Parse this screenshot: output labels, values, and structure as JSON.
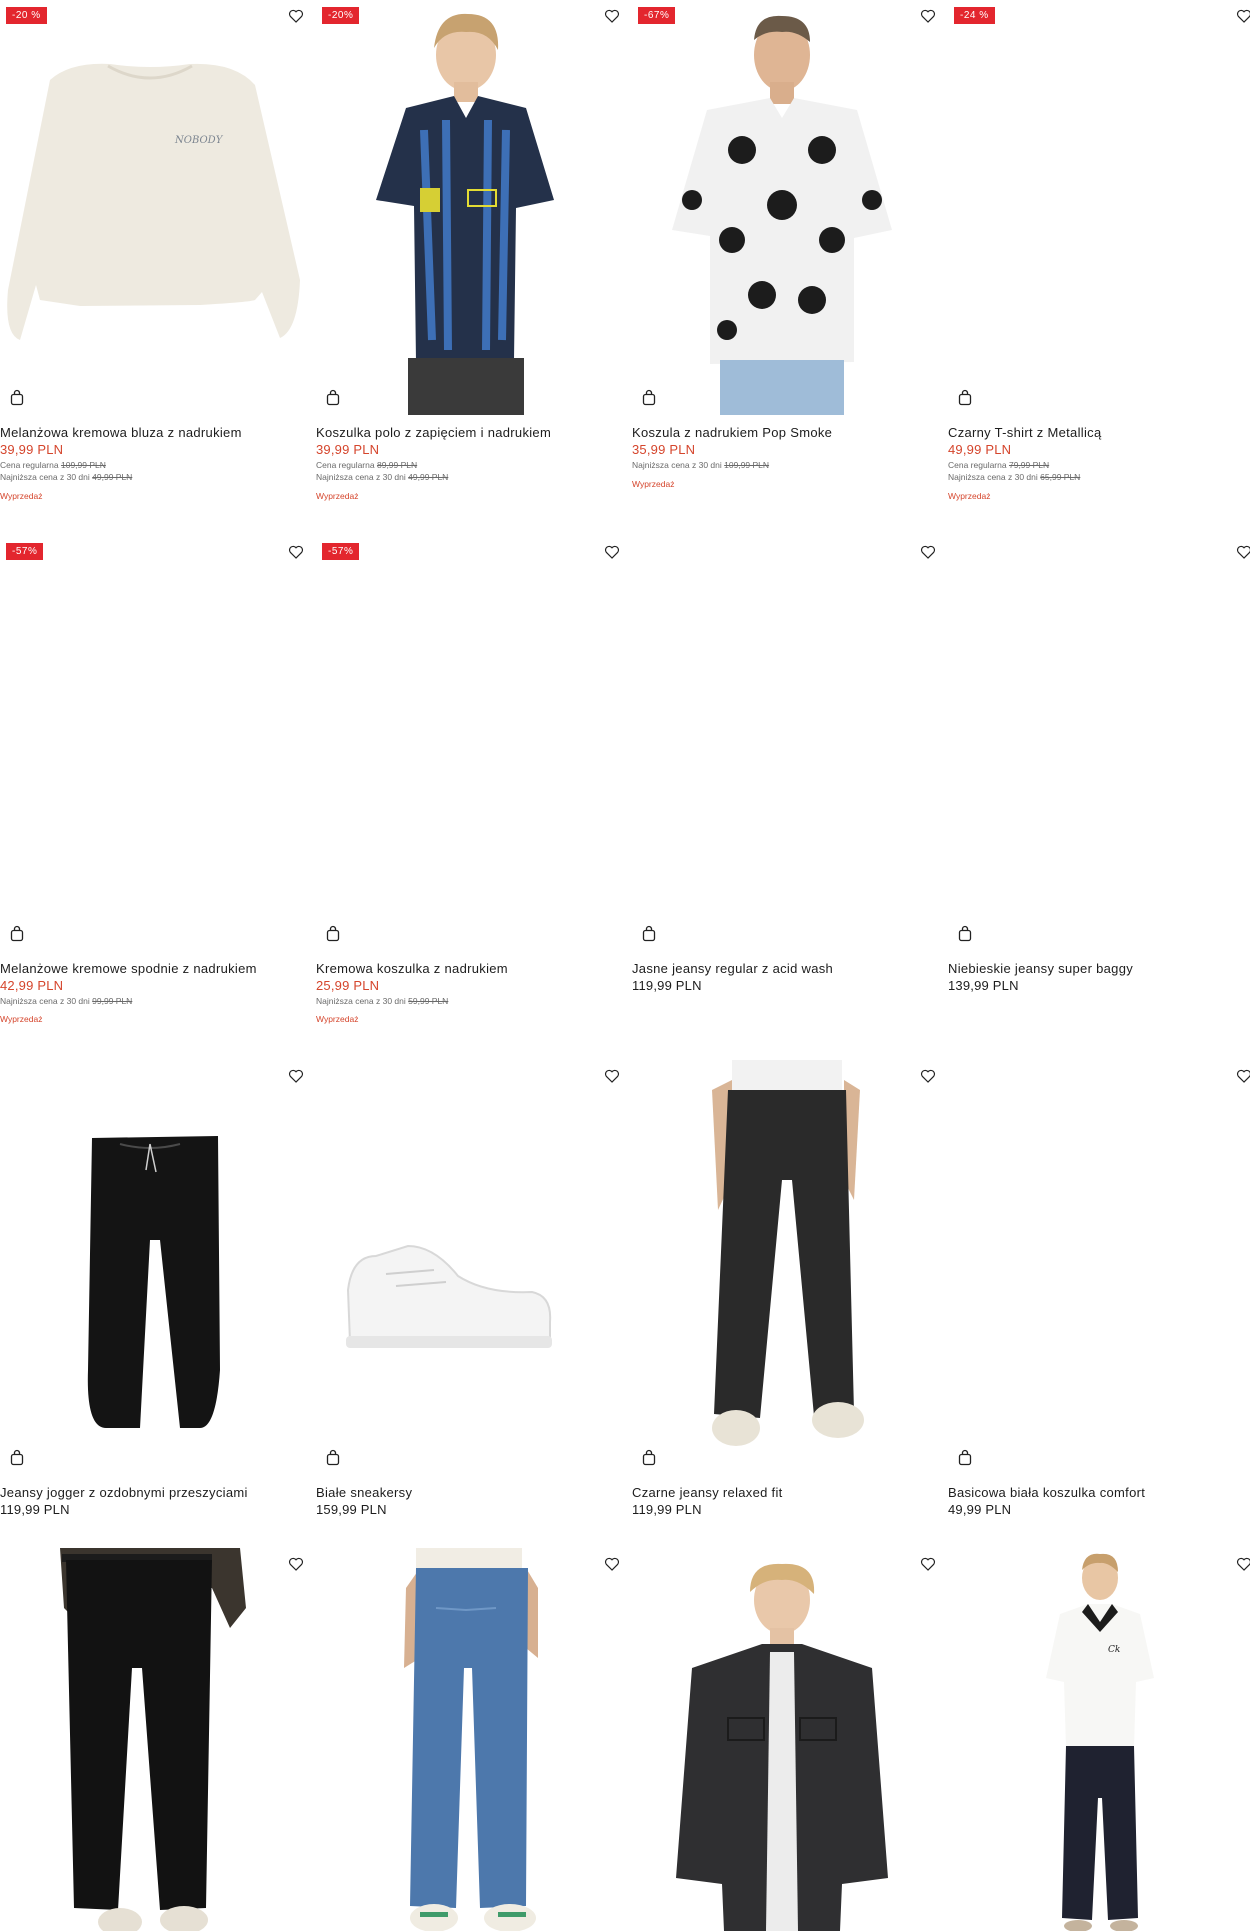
{
  "colors": {
    "sale": "#d5452c",
    "badge": "#e3262e",
    "text": "#1d1d1d",
    "muted": "#6a6a6a"
  },
  "icons": {
    "wishlist": "heart-icon",
    "cart": "shopping-bag-icon"
  },
  "products": [
    {
      "badge": "-20 %",
      "name": "Melanżowa kremowa bluza z nadrukiem",
      "price": "39,99 PLN",
      "sale": true,
      "regular_label": "Cena regularna",
      "regular": "109,99 PLN",
      "lowest_label": "Najniższa cena z 30 dni",
      "lowest": "49,99 PLN",
      "tag": "Wyprzedaż"
    },
    {
      "badge": "-20%",
      "name": "Koszulka polo z zapięciem i nadrukiem",
      "price": "39,99 PLN",
      "sale": true,
      "regular_label": "Cena regularna",
      "regular": "89,99 PLN",
      "lowest_label": "Najniższa cena z 30 dni",
      "lowest": "49,99 PLN",
      "tag": "Wyprzedaż"
    },
    {
      "badge": "-67%",
      "name": "Koszula z nadrukiem Pop Smoke",
      "price": "35,99 PLN",
      "sale": true,
      "lowest_label": "Najniższa cena z 30 dni",
      "lowest": "109,99 PLN",
      "tag": "Wyprzedaż"
    },
    {
      "badge": "-24 %",
      "name": "Czarny T-shirt z Metallicą",
      "price": "49,99 PLN",
      "sale": true,
      "regular_label": "Cena regularna",
      "regular": "79,99 PLN",
      "lowest_label": "Najniższa cena z 30 dni",
      "lowest": "65,99 PLN",
      "tag": "Wyprzedaż"
    },
    {
      "badge": "-57%",
      "name": "Melanżowe kremowe spodnie z nadrukiem",
      "price": "42,99 PLN",
      "sale": true,
      "lowest_label": "Najniższa cena z 30 dni",
      "lowest": "99,99 PLN",
      "tag": "Wyprzedaż"
    },
    {
      "badge": "-57%",
      "name": "Kremowa koszulka z nadrukiem",
      "price": "25,99 PLN",
      "sale": true,
      "lowest_label": "Najniższa cena z 30 dni",
      "lowest": "59,99 PLN",
      "tag": "Wyprzedaż"
    },
    {
      "name": "Jasne jeansy regular z acid wash",
      "price": "119,99 PLN",
      "sale": false
    },
    {
      "name": "Niebieskie jeansy super baggy",
      "price": "139,99 PLN",
      "sale": false
    },
    {
      "name": "Jeansy jogger z ozdobnymi przeszyciami",
      "price": "119,99 PLN",
      "sale": false
    },
    {
      "name": "Białe sneakersy",
      "price": "159,99 PLN",
      "sale": false
    },
    {
      "name": "Czarne jeansy relaxed fit",
      "price": "119,99 PLN",
      "sale": false
    },
    {
      "name": "Basicowa biała koszulka comfort",
      "price": "49,99 PLN",
      "sale": false
    },
    {
      "name": "",
      "price": "",
      "sale": false
    },
    {
      "name": "",
      "price": "",
      "sale": false
    },
    {
      "name": "",
      "price": "",
      "sale": false
    },
    {
      "name": "",
      "price": "",
      "sale": false
    }
  ]
}
